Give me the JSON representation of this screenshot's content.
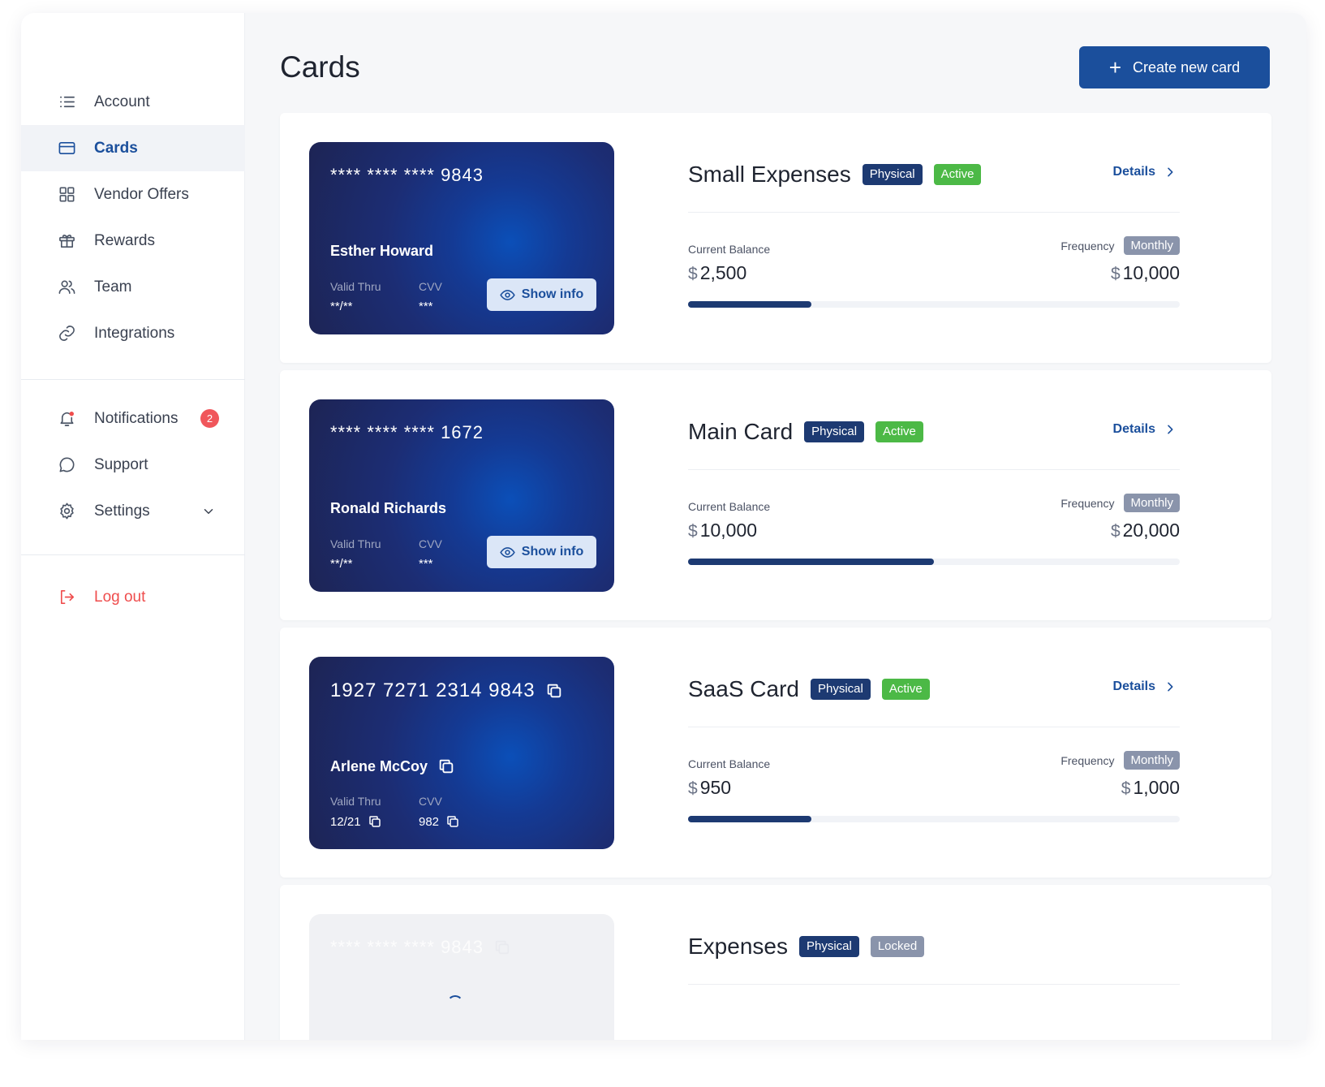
{
  "sidebar": {
    "items": [
      {
        "label": "Account"
      },
      {
        "label": "Cards"
      },
      {
        "label": "Vendor Offers"
      },
      {
        "label": "Rewards"
      },
      {
        "label": "Team"
      },
      {
        "label": "Integrations"
      }
    ],
    "secondary": [
      {
        "label": "Notifications",
        "badge": "2"
      },
      {
        "label": "Support"
      },
      {
        "label": "Settings"
      }
    ],
    "logout": "Log out"
  },
  "header": {
    "title": "Cards",
    "create_button": "Create new card",
    "create_icon": "+"
  },
  "cards": [
    {
      "number": "**** **** **** 9843",
      "holder": "Esther Howard",
      "valid_label": "Valid Thru",
      "valid": "**/**",
      "cvv_label": "CVV",
      "cvv": "***",
      "show_info": "Show info",
      "name": "Small Expenses",
      "type_tag": "Physical",
      "status_tag": "Active",
      "details": "Details",
      "balance_label": "Current Balance",
      "currency": "$",
      "balance": "2,500",
      "frequency_label": "Frequency",
      "frequency": "Monthly",
      "limit": "10,000",
      "progress": 0.25
    },
    {
      "number": "**** **** **** 1672",
      "holder": "Ronald Richards",
      "valid_label": "Valid Thru",
      "valid": "**/**",
      "cvv_label": "CVV",
      "cvv": "***",
      "show_info": "Show info",
      "name": "Main Card",
      "type_tag": "Physical",
      "status_tag": "Active",
      "details": "Details",
      "balance_label": "Current Balance",
      "currency": "$",
      "balance": "10,000",
      "frequency_label": "Frequency",
      "frequency": "Monthly",
      "limit": "20,000",
      "progress": 0.5
    },
    {
      "number": "1927 7271 2314 9843",
      "holder": "Arlene McCoy",
      "valid_label": "Valid Thru",
      "valid": "12/21",
      "cvv_label": "CVV",
      "cvv": "982",
      "name": "SaaS Card",
      "type_tag": "Physical",
      "status_tag": "Active",
      "details": "Details",
      "balance_label": "Current Balance",
      "currency": "$",
      "balance": "950",
      "frequency_label": "Frequency",
      "frequency": "Monthly",
      "limit": "1,000",
      "progress": 0.25
    },
    {
      "number": "**** **** **** 9843",
      "name": "Expenses",
      "type_tag": "Physical",
      "status_tag": "Locked"
    }
  ],
  "colors": {
    "accent": "#1b4f9c",
    "active": "#4cb946",
    "physical": "#1d3a72",
    "danger": "#ef4d4d"
  }
}
